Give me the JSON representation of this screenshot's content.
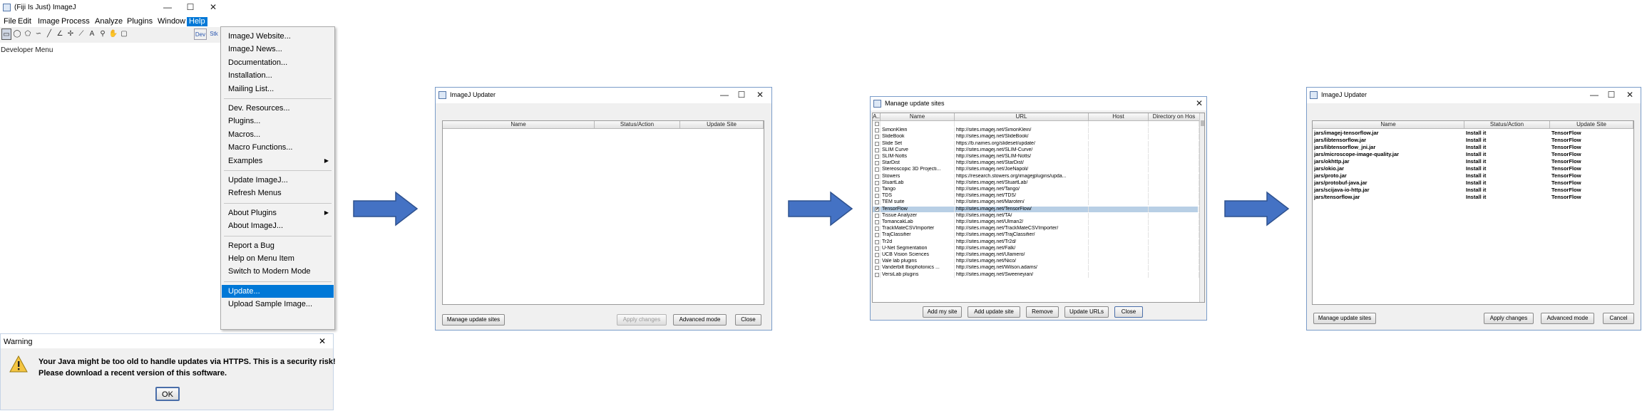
{
  "fiji": {
    "title": "(Fiji Is Just) ImageJ",
    "minimize": "—",
    "maximize": "☐",
    "close": "✕",
    "menus": [
      "File",
      "Edit",
      "Image",
      "Process",
      "Analyze",
      "Plugins",
      "Window",
      "Help"
    ],
    "tools": [
      {
        "icon": "rectangle-tool-icon",
        "glyph": "▭"
      },
      {
        "icon": "oval-tool-icon",
        "glyph": "◯"
      },
      {
        "icon": "polygon-tool-icon",
        "glyph": "⬠"
      },
      {
        "icon": "freehand-tool-icon",
        "glyph": "∽"
      },
      {
        "icon": "line-tool-icon",
        "glyph": "╱"
      },
      {
        "icon": "angle-tool-icon",
        "glyph": "∠"
      },
      {
        "icon": "point-tool-icon",
        "glyph": "✢"
      },
      {
        "icon": "wand-tool-icon",
        "glyph": "⟋"
      },
      {
        "icon": "text-tool-icon",
        "glyph": "A"
      },
      {
        "icon": "zoom-tool-icon",
        "glyph": "⚲"
      },
      {
        "icon": "hand-tool-icon",
        "glyph": "✋"
      },
      {
        "icon": "color-picker-icon",
        "glyph": "▢"
      }
    ],
    "dev_label": "Dev",
    "stk_label": "Stk",
    "developer_menu": "Developer Menu",
    "help_menu": [
      {
        "label": "ImageJ Website..."
      },
      {
        "label": "ImageJ News..."
      },
      {
        "label": "Documentation..."
      },
      {
        "label": "Installation..."
      },
      {
        "label": "Mailing List..."
      },
      {
        "sep": true
      },
      {
        "label": "Dev. Resources..."
      },
      {
        "label": "Plugins..."
      },
      {
        "label": "Macros..."
      },
      {
        "label": "Macro Functions..."
      },
      {
        "label": "Examples",
        "sub": true
      },
      {
        "sep": true
      },
      {
        "label": "Update ImageJ..."
      },
      {
        "label": "Refresh Menus"
      },
      {
        "sep": true
      },
      {
        "label": "About Plugins",
        "sub": true
      },
      {
        "label": "About ImageJ..."
      },
      {
        "sep": true
      },
      {
        "label": "Report a Bug"
      },
      {
        "label": "Help on Menu Item"
      },
      {
        "label": "Switch to Modern Mode"
      },
      {
        "sep": true
      },
      {
        "label": "Update...",
        "highlight": true
      },
      {
        "label": "Upload Sample Image..."
      }
    ]
  },
  "warning": {
    "title": "Warning",
    "close": "✕",
    "line1": "Your Java might be too old to handle updates via HTTPS. This is a security risk!",
    "line2": "Please download a recent version of this software.",
    "ok": "OK"
  },
  "updater1": {
    "title": "ImageJ Updater",
    "minimize": "—",
    "maximize": "☐",
    "close": "✕",
    "columns": [
      "Name",
      "Status/Action",
      "Update Site"
    ],
    "manage": "Manage update sites",
    "apply": "Apply changes",
    "advanced": "Advanced mode",
    "close_btn": "Close"
  },
  "sites": {
    "title": "Manage update sites",
    "close": "✕",
    "columns": [
      "A..",
      "Name",
      "URL",
      "Host",
      "Directory on Hos"
    ],
    "rows": [
      {
        "name": "",
        "url": ""
      },
      {
        "name": "SimonKlein",
        "url": "http://sites.imagej.net/SimonKlein/"
      },
      {
        "name": "SlideBook",
        "url": "http://sites.imagej.net/SlideBook/"
      },
      {
        "name": "Slide Set",
        "url": "https://b.names.org/slideset/update/"
      },
      {
        "name": "SLIM Curve",
        "url": "http://sites.imagej.net/SLIM-Curve/"
      },
      {
        "name": "SLIM-Notts",
        "url": "http://sites.imagej.net/SLIM-Notts/"
      },
      {
        "name": "StarDist",
        "url": "http://sites.imagej.net/StarDist/"
      },
      {
        "name": "Stereoscopic 3D Projecti...",
        "url": "http://sites.imagej.net/JoeNapoli/"
      },
      {
        "name": "Stowers",
        "url": "https://research.stowers.org/imagejplugins/upda..."
      },
      {
        "name": "StuartLab",
        "url": "http://sites.imagej.net/StuartLab/"
      },
      {
        "name": "Tango",
        "url": "http://sites.imagej.net/Tango/"
      },
      {
        "name": "TDS",
        "url": "http://sites.imagej.net/TDS/"
      },
      {
        "name": "TEM suite",
        "url": "http://sites.imagej.net/Maroten/"
      },
      {
        "name": "TensorFlow",
        "url": "http://sites.imagej.net/TensorFlow/",
        "checked": true,
        "selected": true
      },
      {
        "name": "Tissue Analyzer",
        "url": "http://sites.imagej.net/TA/"
      },
      {
        "name": "TomancakLab",
        "url": "http://sites.imagej.net/Ulman2/"
      },
      {
        "name": "TrackMateCSVImporter",
        "url": "http://sites.imagej.net/TrackMateCSVImporter/"
      },
      {
        "name": "TrajClassifier",
        "url": "http://sites.imagej.net/TrajClassifier/"
      },
      {
        "name": "Tr2d",
        "url": "http://sites.imagej.net/Tr2d/"
      },
      {
        "name": "U-Net Segmentation",
        "url": "http://sites.imagej.net/Falk/"
      },
      {
        "name": "UCB Vision Sciences",
        "url": "http://sites.imagej.net/Ulamero/"
      },
      {
        "name": "Vale lab plugins",
        "url": "http://sites.imagej.net/Nico/"
      },
      {
        "name": "Vanderbilt Biophotonics ...",
        "url": "http://sites.imagej.net/Wilson.adams/"
      },
      {
        "name": "VersiLab plugins",
        "url": "http://sites.imagej.net/Sweeneyian/"
      }
    ],
    "add_my_site": "Add my site",
    "add_update_site": "Add update site",
    "remove": "Remove",
    "update_urls": "Update URLs",
    "close_btn": "Close"
  },
  "updater2": {
    "title": "ImageJ Updater",
    "minimize": "—",
    "maximize": "☐",
    "close": "✕",
    "columns": [
      "Name",
      "Status/Action",
      "Update Site"
    ],
    "rows": [
      {
        "name": "jars/imagej-tensorflow.jar",
        "status": "Install it",
        "site": "TensorFlow"
      },
      {
        "name": "jars/libtensorflow.jar",
        "status": "Install it",
        "site": "TensorFlow"
      },
      {
        "name": "jars/libtensorflow_jni.jar",
        "status": "Install it",
        "site": "TensorFlow"
      },
      {
        "name": "jars/microscope-image-quality.jar",
        "status": "Install it",
        "site": "TensorFlow"
      },
      {
        "name": "jars/okhttp.jar",
        "status": "Install it",
        "site": "TensorFlow"
      },
      {
        "name": "jars/okio.jar",
        "status": "Install it",
        "site": "TensorFlow"
      },
      {
        "name": "jars/proto.jar",
        "status": "Install it",
        "site": "TensorFlow"
      },
      {
        "name": "jars/protobuf-java.jar",
        "status": "Install it",
        "site": "TensorFlow"
      },
      {
        "name": "jars/scijava-io-http.jar",
        "status": "Install it",
        "site": "TensorFlow"
      },
      {
        "name": "jars/tensorflow.jar",
        "status": "Install it",
        "site": "TensorFlow"
      }
    ],
    "manage": "Manage update sites",
    "apply": "Apply changes",
    "advanced": "Advanced mode",
    "cancel": "Cancel"
  },
  "colors": {
    "accent": "#0078d7",
    "arrow": "#4472c4",
    "arrow_border": "#2f528f"
  }
}
